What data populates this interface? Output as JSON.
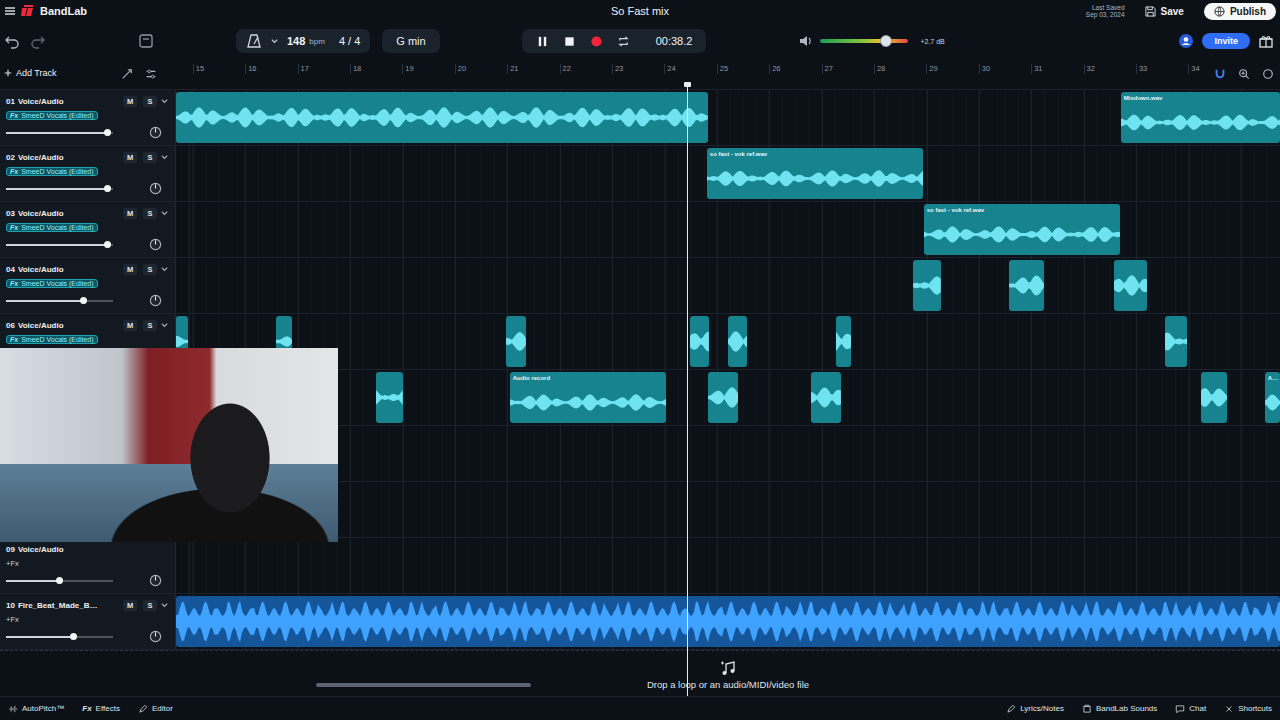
{
  "app": {
    "brand": "BandLab",
    "project_title": "So Fast mix",
    "last_saved_label": "Last Saved",
    "last_saved_date": "Sep 03, 2024",
    "save": "Save",
    "publish": "Publish"
  },
  "toolbar": {
    "tempo": "148",
    "tempo_unit": "bpm",
    "time_signature": "4 / 4",
    "key": "G min",
    "time": "00:38.2",
    "transport": [
      {
        "name": "pause",
        "active": false
      },
      {
        "name": "stop",
        "active": false
      },
      {
        "name": "record",
        "active": true
      },
      {
        "name": "loop",
        "active": false
      }
    ],
    "master_volume": {
      "level": 0.75,
      "reading": "+2.7 dB"
    },
    "invite": "Invite"
  },
  "track_list": {
    "add_track": "Add Track"
  },
  "timeline": {
    "bars": [
      "15",
      "16",
      "17",
      "18",
      "19",
      "20",
      "21",
      "22",
      "23",
      "24",
      "25",
      "26",
      "27",
      "28",
      "29",
      "30",
      "31",
      "32",
      "33",
      "34"
    ],
    "playhead_bar": 24.43,
    "scroll": {
      "start": 0.247,
      "size": 0.168
    },
    "drop_hint": "Drop a loop or an audio/MIDI/video file"
  },
  "tracks": [
    {
      "number": "01",
      "name": "Voice/Audio",
      "mute": {
        "label": "M",
        "on": false
      },
      "solo": {
        "label": "S",
        "on": false
      },
      "effect": {
        "kind": "preset",
        "glyph": "Fx",
        "label": "SmeeD Vocals (Edited)"
      },
      "volume": 0.95,
      "clips": [
        {
          "kind": "vocal",
          "start": 14.68,
          "end": 24.83,
          "color": "#17838f",
          "wave": "#6fe3ef"
        },
        {
          "kind": "vocal",
          "label": "Mixdown.wav",
          "start": 32.71,
          "end": 35.75,
          "color": "#17838f",
          "wave": "#6fe3ef"
        }
      ]
    },
    {
      "number": "02",
      "name": "Voice/Audio",
      "mute": {
        "label": "M",
        "on": false
      },
      "solo": {
        "label": "S",
        "on": false
      },
      "effect": {
        "kind": "preset",
        "glyph": "Fx",
        "label": "SmeeD Vocals (Edited)"
      },
      "volume": 0.95,
      "clips": [
        {
          "kind": "vocal",
          "label": "so fast - vok ref.wav",
          "start": 24.81,
          "end": 28.94,
          "color": "#17838f",
          "wave": "#6fe3ef"
        }
      ]
    },
    {
      "number": "03",
      "name": "Voice/Audio",
      "mute": {
        "label": "M",
        "on": false
      },
      "solo": {
        "label": "S",
        "on": false
      },
      "effect": {
        "kind": "preset",
        "glyph": "Fx",
        "label": "SmeeD Vocals (Edited)"
      },
      "volume": 0.95,
      "clips": [
        {
          "kind": "vocal",
          "label": "so fast - vok ref.wav",
          "start": 28.95,
          "end": 32.69,
          "color": "#17838f",
          "wave": "#6fe3ef"
        }
      ]
    },
    {
      "number": "04",
      "name": "Voice/Audio",
      "mute": {
        "label": "M",
        "on": false
      },
      "solo": {
        "label": "S",
        "on": false
      },
      "effect": {
        "kind": "preset",
        "glyph": "Fx",
        "label": "SmeeD Vocals (Edited)"
      },
      "volume": 0.72,
      "clips": [
        {
          "kind": "vocal",
          "start": 28.75,
          "end": 29.28,
          "color": "#17838f",
          "wave": "#6fe3ef"
        },
        {
          "kind": "vocal",
          "start": 30.58,
          "end": 31.25,
          "color": "#17838f",
          "wave": "#6fe3ef"
        },
        {
          "kind": "vocal",
          "start": 32.58,
          "end": 33.21,
          "color": "#17838f",
          "wave": "#6fe3ef"
        }
      ]
    },
    {
      "number": "06",
      "name": "Voice/Audio",
      "mute": {
        "label": "M",
        "on": false
      },
      "solo": {
        "label": "S",
        "on": false
      },
      "effect": {
        "kind": "preset",
        "glyph": "Fx",
        "label": "SmeeD Vocals (Edited)"
      },
      "volume": 0.95,
      "clips": [
        {
          "kind": "vocal",
          "start": 14.68,
          "end": 14.91,
          "color": "#17838f",
          "wave": "#6fe3ef"
        },
        {
          "kind": "vocal",
          "start": 16.59,
          "end": 16.9,
          "color": "#17838f",
          "wave": "#6fe3ef"
        },
        {
          "kind": "vocal",
          "start": 20.98,
          "end": 21.36,
          "color": "#17838f",
          "wave": "#6fe3ef"
        },
        {
          "kind": "vocal",
          "start": 24.49,
          "end": 24.85,
          "color": "#17838f",
          "wave": "#6fe3ef"
        },
        {
          "kind": "vocal",
          "start": 25.21,
          "end": 25.58,
          "color": "#17838f",
          "wave": "#6fe3ef"
        },
        {
          "kind": "vocal",
          "start": 27.27,
          "end": 27.56,
          "color": "#17838f",
          "wave": "#6fe3ef"
        },
        {
          "kind": "vocal",
          "start": 33.55,
          "end": 33.97,
          "color": "#17838f",
          "wave": "#6fe3ef"
        }
      ]
    },
    {
      "clips": [
        {
          "kind": "vocal",
          "start": 18.5,
          "end": 19.01,
          "color": "#17838f",
          "wave": "#6fe3ef"
        },
        {
          "kind": "vocal",
          "label": "Audio record",
          "start": 21.05,
          "end": 24.03,
          "color": "#17838f",
          "wave": "#6fe3ef"
        },
        {
          "kind": "vocal",
          "start": 24.83,
          "end": 25.41,
          "color": "#17838f",
          "wave": "#6fe3ef"
        },
        {
          "kind": "vocal",
          "start": 26.8,
          "end": 27.37,
          "color": "#17838f",
          "wave": "#6fe3ef"
        },
        {
          "kind": "vocal",
          "start": 34.24,
          "end": 34.74,
          "color": "#17838f",
          "wave": "#6fe3ef"
        },
        {
          "kind": "vocal",
          "label": "A…",
          "start": 35.46,
          "end": 35.75,
          "color": "#17838f",
          "wave": "#6fe3ef"
        }
      ]
    },
    {
      "clips": []
    },
    {
      "clips": []
    },
    {
      "number": "09",
      "name": "Voice/Audio",
      "effect": {
        "kind": "add",
        "label": "+Fx"
      },
      "volume": 0.5,
      "clips": []
    },
    {
      "number": "10",
      "name": "Fire_Beat_Made_B…",
      "mute": {
        "label": "M",
        "on": false
      },
      "solo": {
        "label": "S",
        "on": false
      },
      "effect": {
        "kind": "add",
        "label": "+Fx"
      },
      "volume": 0.63,
      "clips": [
        {
          "kind": "beat",
          "start": 14.68,
          "end": 35.75,
          "color": "#15569a",
          "wave": "#3fa2ff"
        }
      ]
    }
  ],
  "bottom_bar": {
    "left": [
      {
        "label": "AutoPitch™"
      },
      {
        "glyph": "Fx",
        "label": "Effects"
      },
      {
        "label": "Editor"
      }
    ],
    "right": [
      {
        "label": "Lyrics/Notes"
      },
      {
        "label": "BandLab Sounds"
      },
      {
        "label": "Chat"
      },
      {
        "label": "Shortcuts"
      }
    ]
  }
}
